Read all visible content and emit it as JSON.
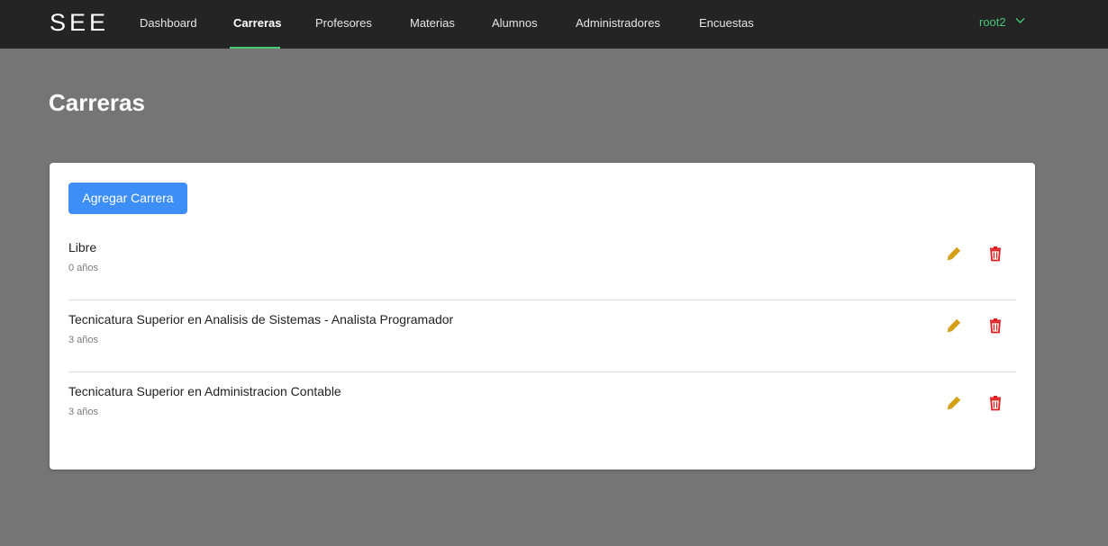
{
  "app": {
    "logo": "SEE"
  },
  "nav": {
    "items": [
      {
        "label": "Dashboard"
      },
      {
        "label": "Carreras",
        "active": true
      },
      {
        "label": "Profesores"
      },
      {
        "label": "Materias"
      },
      {
        "label": "Alumnos"
      },
      {
        "label": "Administradores"
      },
      {
        "label": "Encuestas"
      }
    ],
    "user": "root2"
  },
  "page": {
    "title": "Carreras"
  },
  "toolbar": {
    "add_label": "Agregar Carrera"
  },
  "careers": [
    {
      "name": "Libre",
      "years": "0 años"
    },
    {
      "name": "Tecnicatura Superior en Analisis de Sistemas - Analista Programador",
      "years": "3 años"
    },
    {
      "name": "Tecnicatura Superior en Administracion Contable",
      "years": "3 años"
    }
  ],
  "icons": {
    "edit": "pencil-icon",
    "delete": "trash-icon",
    "user_menu": "chevron-down-icon"
  },
  "colors": {
    "nav_bg": "#242424",
    "page_bg": "#757575",
    "accent": "#48c774",
    "primary_button": "#3e8ef7",
    "edit_icon": "#d4a017",
    "delete_icon": "#e02020"
  }
}
